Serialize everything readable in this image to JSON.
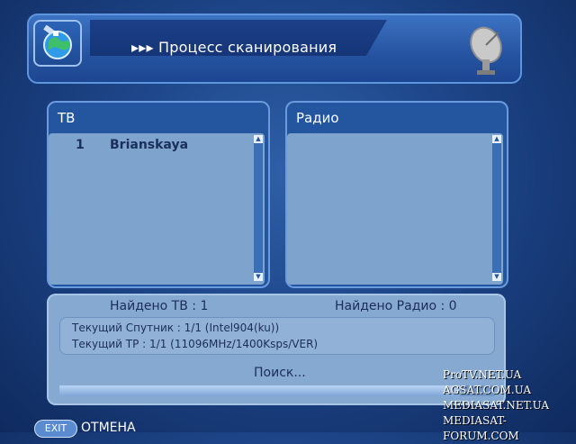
{
  "header": {
    "title": "▸▸▸ Процесс сканирования",
    "left_icon": "satellite-globe-icon",
    "right_icon": "satellite-dish-icon"
  },
  "tv_panel": {
    "title": "ТВ",
    "channels": [
      {
        "number": "1",
        "name": "Brianskaya"
      }
    ]
  },
  "radio_panel": {
    "title": "Радио",
    "channels": []
  },
  "status": {
    "found_tv": "Найдено ТВ : 1",
    "found_radio": "Найдено Радио : 0",
    "current_satellite": "Текущий Спутник : 1/1  (Intel904(ku))",
    "current_tp": "Текущий ТР : 1/1  (11096MHz/1400Ksps/VER)",
    "search_text": "Поиск...",
    "progress": 0.92
  },
  "footer": {
    "exit_key": "EXIT",
    "exit_label": "ОТМЕНА"
  },
  "watermark": {
    "lines": [
      "ProTV.NET.UA",
      "AGSAT.COM.UA",
      "MEDIASAT.NET.UA",
      "MEDIASAT-FORUM.COM"
    ]
  },
  "colors": {
    "background": "#1d4588",
    "panel": "#2456a0",
    "list": "#7ea3cc",
    "status_panel": "#86a9d1"
  }
}
